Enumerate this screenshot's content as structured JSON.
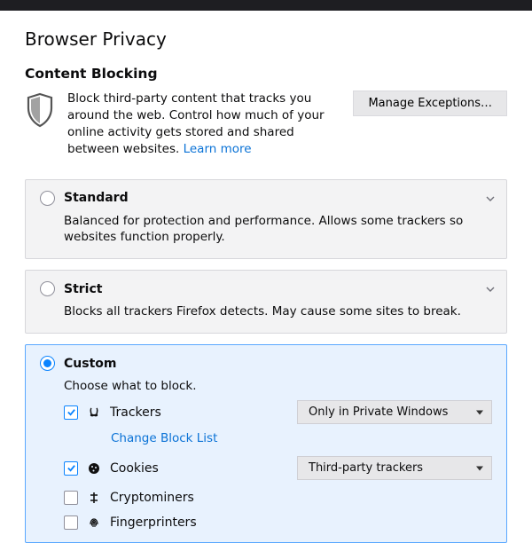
{
  "title": "Browser Privacy",
  "section": {
    "heading": "Content Blocking",
    "desc_prefix": "Block third-party content that tracks you around the web. Control how much of your online activity gets stored and shared between websites.  ",
    "learn_more": "Learn more",
    "exceptions_btn": "Manage Exceptions…"
  },
  "modes": {
    "standard": {
      "title": "Standard",
      "desc": "Balanced for protection and performance. Allows some trackers so websites function properly."
    },
    "strict": {
      "title": "Strict",
      "desc": "Blocks all trackers Firefox detects. May cause some sites to break."
    },
    "custom": {
      "title": "Custom",
      "desc": "Choose what to block.",
      "trackers_label": "Trackers",
      "trackers_select": "Only in Private Windows",
      "trackers_link": "Change Block List",
      "cookies_label": "Cookies",
      "cookies_select": "Third-party trackers",
      "crypto_label": "Cryptominers",
      "fp_label": "Fingerprinters"
    }
  }
}
